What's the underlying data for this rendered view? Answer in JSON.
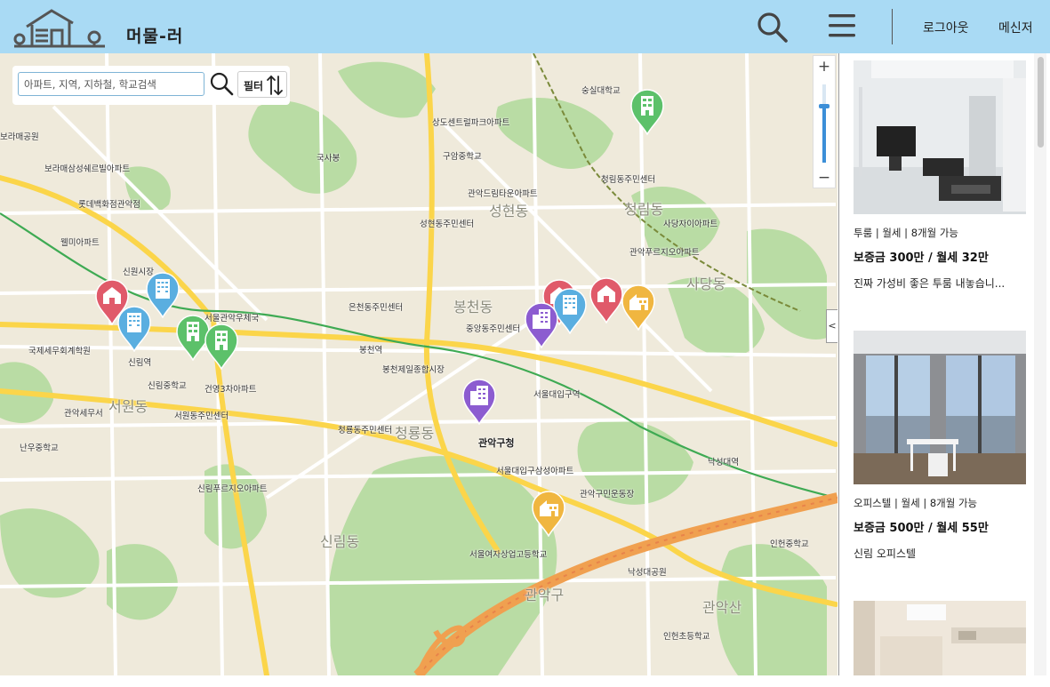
{
  "header": {
    "app_title": "머물-러",
    "logout_label": "로그아웃",
    "messenger_label": "메신저"
  },
  "map_search": {
    "placeholder": "아파트, 지역, 지하철, 학교검색",
    "filter_label": "필터"
  },
  "map_zoom": {
    "plus": "+",
    "minus": "−",
    "level_fraction": 0.72
  },
  "panel_toggle": "<",
  "map_labels": [
    "보라매공원",
    "보라매삼성쉐르빌아파트",
    "롯데백화점관악점",
    "웰미아파트",
    "신원시장",
    "국제세무회계학원",
    "관악세무서",
    "난우중학교",
    "신림중학교",
    "서원동주민센터",
    "건영3차아파트",
    "신림푸르지오아파트",
    "청룡동주민센터",
    "관악구청",
    "봉천제일종합시장",
    "성현동주민센터",
    "관악드림타운아파트",
    "청림동주민센터",
    "사당자이아파트",
    "관악푸르지오아파트",
    "숭실대학교",
    "상도센트럴파크아파트",
    "구암중학교",
    "국사봉",
    "은천동주민센터",
    "중앙동주민센터",
    "봉천동",
    "신림동",
    "서울대입구삼성아파트",
    "서울여자상업고등학교",
    "관악구민운동장",
    "낙성대공원",
    "인헌중학교",
    "인헌초등학교",
    "관악산",
    "봉천역",
    "서울대입구역",
    "낙성대역",
    "신림역",
    "서울관악우체국",
    "서원동",
    "청룡동",
    "성현동",
    "청림동",
    "사당동",
    "관악구"
  ],
  "pins": [
    {
      "icon": "house-icon",
      "color": "#e05a6a"
    },
    {
      "icon": "building-icon",
      "color": "#5aaee0"
    },
    {
      "icon": "building-icon",
      "color": "#5aaee0"
    },
    {
      "icon": "apartment-icon",
      "color": "#5cc16a"
    },
    {
      "icon": "apartment-icon",
      "color": "#5cc16a"
    },
    {
      "icon": "apartment-icon",
      "color": "#5cc16a"
    },
    {
      "icon": "house-icon",
      "color": "#e05a6a"
    },
    {
      "icon": "house-icon",
      "color": "#e05a6a"
    },
    {
      "icon": "building-icon",
      "color": "#5aaee0"
    },
    {
      "icon": "office-icon",
      "color": "#8c5cd0"
    },
    {
      "icon": "office-icon",
      "color": "#8c5cd0"
    },
    {
      "icon": "shop-icon",
      "color": "#f0b640"
    },
    {
      "icon": "shop-icon",
      "color": "#f0b640"
    }
  ],
  "listings": [
    {
      "meta": "투룸 | 월세 | 8개월 가능",
      "price": "보증금 300만 / 월세 32만",
      "desc": "진짜 가성비 좋은 투룸 내놓습니..."
    },
    {
      "meta": "오피스텔 | 월세 | 8개월 가능",
      "price": "보증금 500만 / 월세 55만",
      "desc": "신림 오피스텔"
    },
    {
      "meta": "",
      "price": "",
      "desc": ""
    }
  ],
  "colors": {
    "header_bg": "#a9daf4",
    "park": "#b9dca4",
    "road": "#fbd54a",
    "highway": "#f0a050",
    "subway": "#3eaa53"
  }
}
